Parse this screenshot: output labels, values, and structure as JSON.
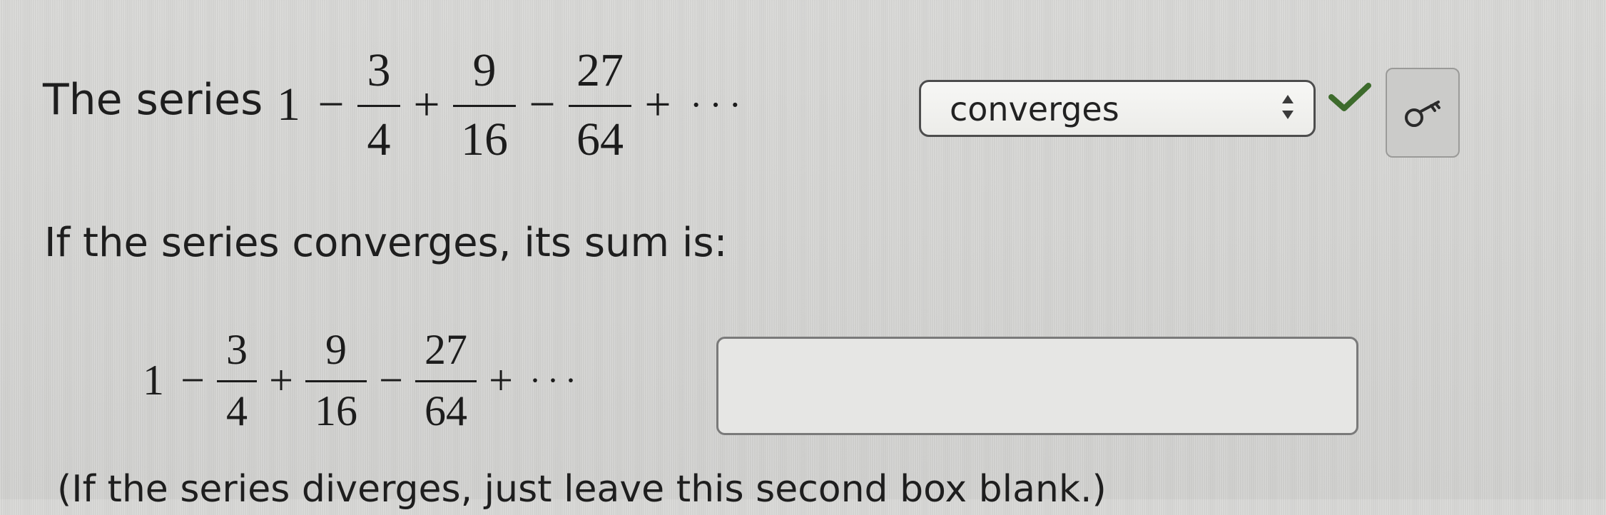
{
  "question": {
    "label": "The series",
    "series": {
      "first": "1",
      "op1": "−",
      "t1": {
        "num": "3",
        "den": "4"
      },
      "op2": "+",
      "t2": {
        "num": "9",
        "den": "16"
      },
      "op3": "−",
      "t3": {
        "num": "27",
        "den": "64"
      },
      "op4": "+",
      "dots": "···"
    },
    "select": {
      "value": "converges"
    },
    "status_icon": "checkmark-icon",
    "status_color": "#3d6b2c",
    "key_icon": "key-icon"
  },
  "sum_prompt": "If the series converges, its sum is:",
  "sum_series": {
    "first": "1",
    "op1": "−",
    "t1": {
      "num": "3",
      "den": "4"
    },
    "op2": "+",
    "t2": {
      "num": "9",
      "den": "16"
    },
    "op3": "−",
    "t3": {
      "num": "27",
      "den": "64"
    },
    "op4": "+",
    "dots": "···"
  },
  "sum_answer": {
    "value": ""
  },
  "note": "(If the series diverges, just leave this second box blank.)"
}
